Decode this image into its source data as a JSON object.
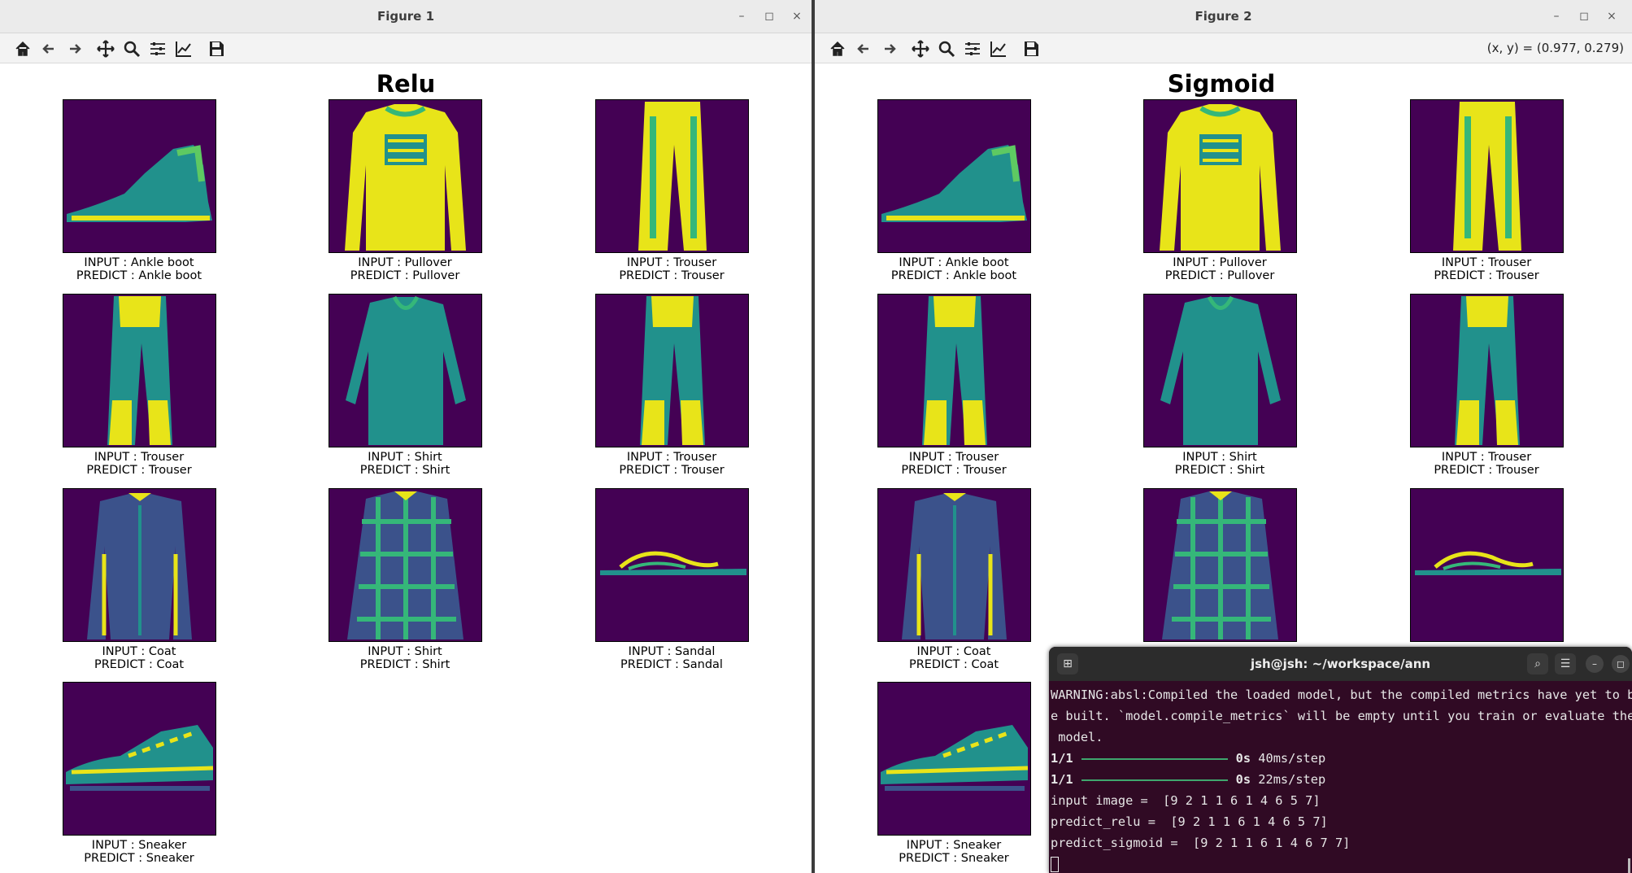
{
  "figure1": {
    "window_title": "Figure 1",
    "plot_title": "Relu",
    "images": [
      {
        "icon": "ankle-boot-image",
        "input": "INPUT : Ankle boot",
        "predict": "PREDICT : Ankle boot"
      },
      {
        "icon": "pullover-image",
        "input": "INPUT : Pullover",
        "predict": "PREDICT : Pullover"
      },
      {
        "icon": "trouser-image",
        "input": "INPUT : Trouser",
        "predict": "PREDICT : Trouser"
      },
      {
        "icon": "trouser-image",
        "input": "INPUT : Trouser",
        "predict": "PREDICT : Trouser"
      },
      {
        "icon": "shirt-image",
        "input": "INPUT : Shirt",
        "predict": "PREDICT : Shirt"
      },
      {
        "icon": "trouser-image",
        "input": "INPUT : Trouser",
        "predict": "PREDICT : Trouser"
      },
      {
        "icon": "coat-image",
        "input": "INPUT : Coat",
        "predict": "PREDICT : Coat"
      },
      {
        "icon": "plaid-shirt-image",
        "input": "INPUT : Shirt",
        "predict": "PREDICT : Shirt"
      },
      {
        "icon": "sandal-image",
        "input": "INPUT : Sandal",
        "predict": "PREDICT : Sandal"
      },
      {
        "icon": "sneaker-image",
        "input": "INPUT : Sneaker",
        "predict": "PREDICT : Sneaker"
      }
    ]
  },
  "figure2": {
    "window_title": "Figure 2",
    "plot_title": "Sigmoid",
    "coords": "(x, y) = (0.977, 0.279)",
    "images": [
      {
        "icon": "ankle-boot-image",
        "input": "INPUT : Ankle boot",
        "predict": "PREDICT : Ankle boot"
      },
      {
        "icon": "pullover-image",
        "input": "INPUT : Pullover",
        "predict": "PREDICT : Pullover"
      },
      {
        "icon": "trouser-image",
        "input": "INPUT : Trouser",
        "predict": "PREDICT : Trouser"
      },
      {
        "icon": "trouser-image",
        "input": "INPUT : Trouser",
        "predict": "PREDICT : Trouser"
      },
      {
        "icon": "shirt-image",
        "input": "INPUT : Shirt",
        "predict": "PREDICT : Shirt"
      },
      {
        "icon": "trouser-image",
        "input": "INPUT : Trouser",
        "predict": "PREDICT : Trouser"
      },
      {
        "icon": "coat-image",
        "input": "INPUT : Coat",
        "predict": "PREDICT : Coat"
      },
      {
        "icon": "plaid-shirt-image",
        "input": "",
        "predict": ""
      },
      {
        "icon": "sandal-image",
        "input": "",
        "predict": ""
      },
      {
        "icon": "sneaker-image",
        "input": "INPUT : Sneaker",
        "predict": "PREDICT : Sneaker"
      }
    ]
  },
  "toolbar_icons": [
    "home-icon",
    "back-icon",
    "forward-icon",
    "pan-icon",
    "zoom-icon",
    "configure-icon",
    "edit-axis-icon",
    "save-icon"
  ],
  "window_controls": {
    "minimize": "–",
    "maximize": "◻",
    "close": "×"
  },
  "terminal": {
    "title": "jsh@jsh: ~/workspace/ann",
    "lines": {
      "w1": "WARNING:absl:Compiled the loaded model, but the compiled metrics have yet to b",
      "w2": "e built. `model.compile_metrics` will be empty until you train or evaluate the",
      "w3": " model.",
      "p1_step": "1/1",
      "p1_time": "0s",
      "p1_rate": " 40ms/step",
      "p2_step": "1/1",
      "p2_time": "0s",
      "p2_rate": " 22ms/step",
      "input": "input image =  [9 2 1 1 6 1 4 6 5 7]",
      "relu": "predict_relu =  [9 2 1 1 6 1 4 6 5 7]",
      "sigmoid": "predict_sigmoid =  [9 2 1 1 6 1 4 6 7 7]"
    }
  },
  "colors": {
    "viridis_bg": "#440154",
    "terminal_bg": "#300a24",
    "progress_bar": "#3fa66e"
  }
}
